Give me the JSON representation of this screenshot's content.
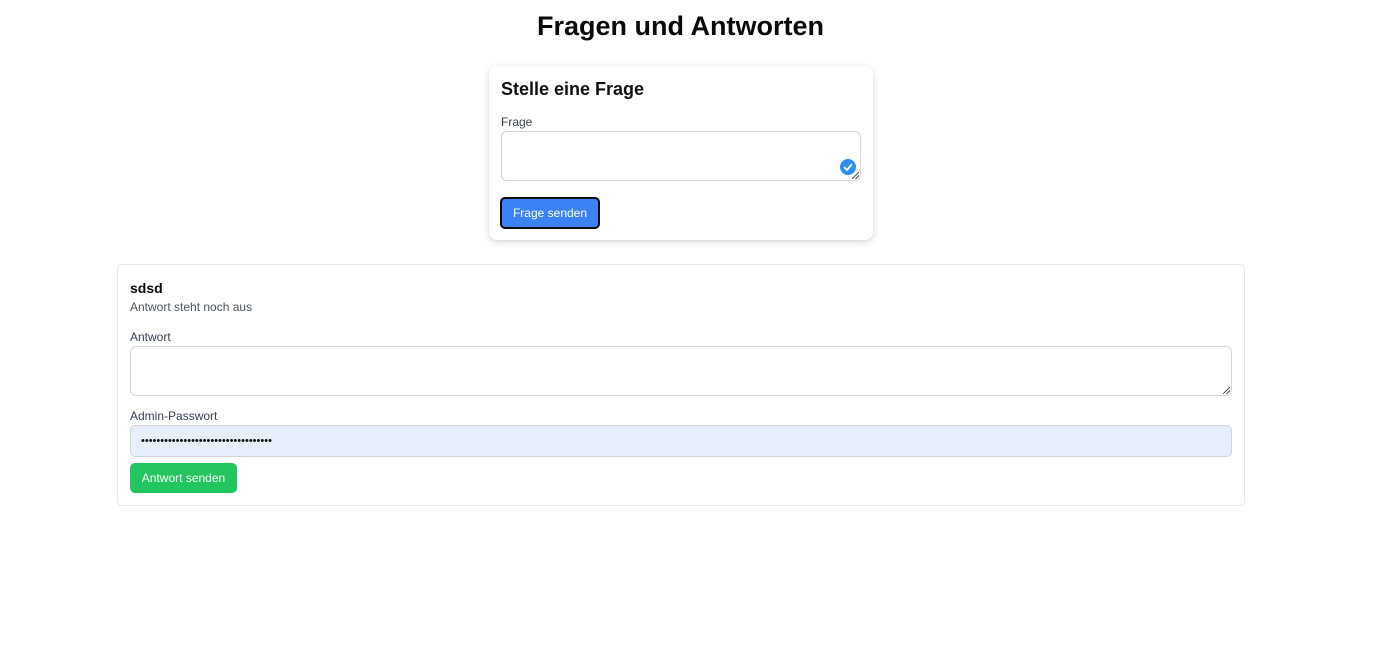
{
  "page": {
    "title": "Fragen und Antworten"
  },
  "ask_form": {
    "heading": "Stelle eine Frage",
    "question_label": "Frage",
    "question_value": "",
    "submit_label": "Frage senden"
  },
  "questions": [
    {
      "text": "sdsd",
      "status": "Antwort steht noch aus",
      "answer_label": "Antwort",
      "answer_value": "",
      "password_label": "Admin-Passwort",
      "password_value": "••••••••••••••••••••••••••••••••••",
      "submit_label": "Antwort senden"
    }
  ],
  "colors": {
    "primary_button": "#3b82f6",
    "success_button": "#22c55e",
    "autofill_background": "#e8effc",
    "check_badge": "#2b8ff2"
  },
  "icons": {
    "field_check": "check-circle-icon",
    "resize_handle": "resize-grip-icon"
  }
}
